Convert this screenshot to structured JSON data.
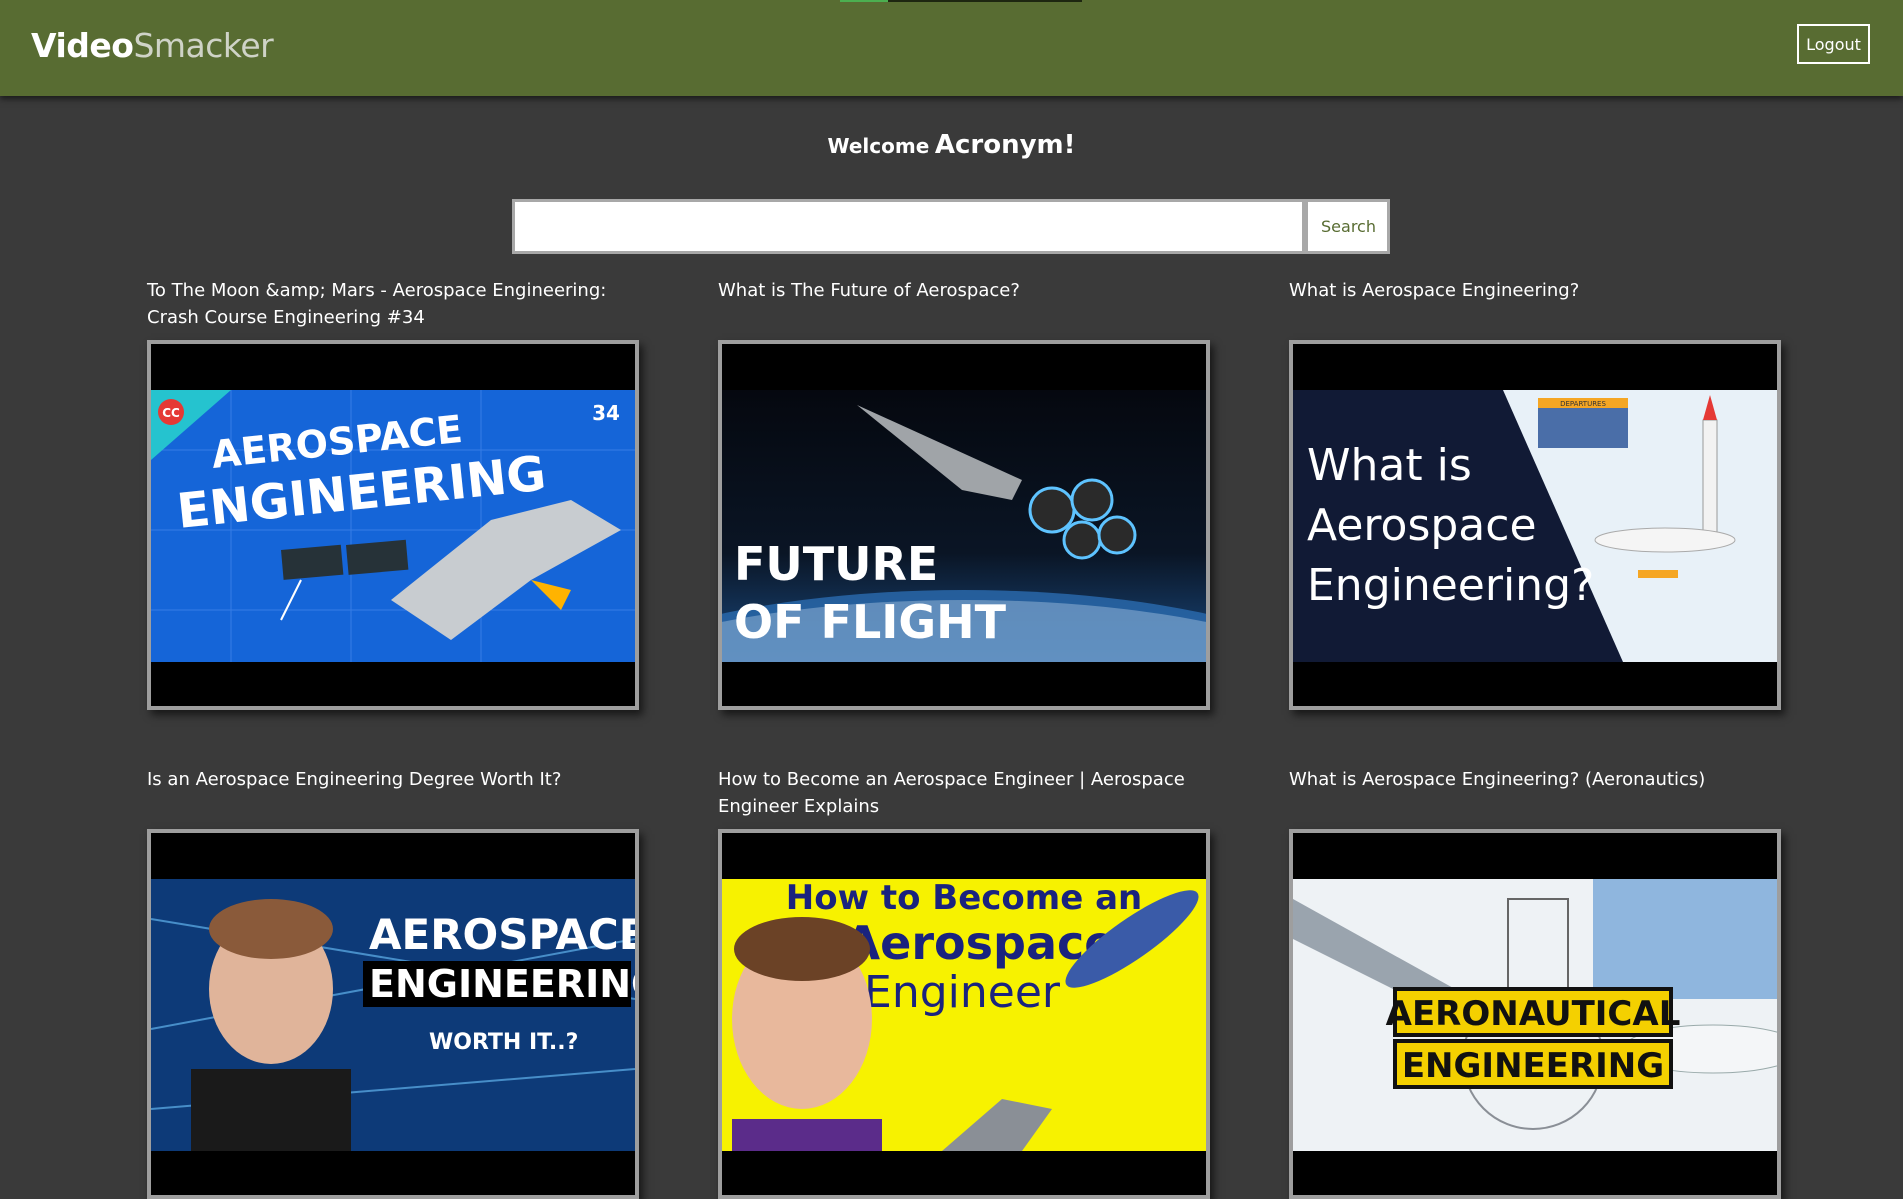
{
  "app": {
    "logo_part1": "Video",
    "logo_part2": "Smacker",
    "logout_label": "Logout",
    "colors": {
      "header": "#586c32",
      "background": "#3a3a3a",
      "accent": "#586c32"
    }
  },
  "welcome": {
    "prefix": "Welcome",
    "username": "Acronym!"
  },
  "search": {
    "value": "",
    "placeholder": "",
    "button_label": "Search"
  },
  "videos": [
    {
      "title": "To The Moon &amp; Mars - Aerospace Engineering: Crash Course Engineering #34",
      "thumb": {
        "line1": "AEROSPACE",
        "line2": "ENGINEERING",
        "badge": "34",
        "logo": "CC"
      }
    },
    {
      "title": "What is The Future of Aerospace?",
      "thumb": {
        "line1": "FUTURE",
        "line2": "OF FLIGHT"
      }
    },
    {
      "title": "What is Aerospace Engineering?",
      "thumb": {
        "line1": "What is",
        "line2": "Aerospace",
        "line3": "Engineering?",
        "board": "DEPARTURES"
      }
    },
    {
      "title": "Is an Aerospace Engineering Degree Worth It?",
      "thumb": {
        "line1": "AEROSPACE",
        "line2": "ENGINEERING",
        "line3": "WORTH IT..?"
      }
    },
    {
      "title": "How to Become an Aerospace Engineer | Aerospace Engineer Explains",
      "thumb": {
        "line1": "How to Become an",
        "line2": "Aerospace",
        "line3": "Engineer"
      }
    },
    {
      "title": "What is Aerospace Engineering? (Aeronautics)",
      "thumb": {
        "line1": "AERONAUTICAL",
        "line2": "ENGINEERING"
      }
    }
  ]
}
